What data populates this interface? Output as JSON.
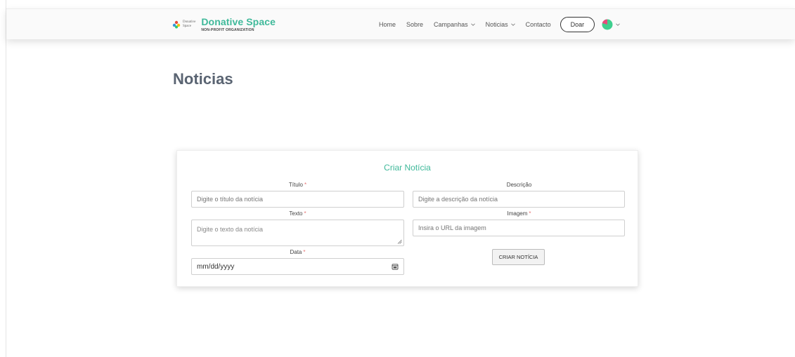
{
  "brand": {
    "logo_small_line1": "Donative",
    "logo_small_line2": "Space",
    "name": "Donative Space",
    "tagline": "NON-PROFIT ORGANIZATION"
  },
  "nav": {
    "items": [
      {
        "label": "Home",
        "dropdown": false
      },
      {
        "label": "Sobre",
        "dropdown": false
      },
      {
        "label": "Campanhas",
        "dropdown": true
      },
      {
        "label": "Noticias",
        "dropdown": true
      },
      {
        "label": "Contacto",
        "dropdown": false
      }
    ],
    "donate_label": "Doar"
  },
  "page": {
    "title": "Noticias"
  },
  "form": {
    "title": "Criar Notícia",
    "required_mark": "*",
    "titulo": {
      "label": "Título",
      "placeholder": "Digite o título da notícia",
      "required": true
    },
    "descricao": {
      "label": "Descrição",
      "placeholder": "Digite a descrição da notícia",
      "required": false
    },
    "texto": {
      "label": "Texto",
      "placeholder": "Digite o texto da notícia",
      "required": true
    },
    "imagem": {
      "label": "Imagem",
      "placeholder": "Insira o URL da imagem",
      "required": true
    },
    "data": {
      "label": "Data",
      "value": "mm/dd/yyyy",
      "required": true
    },
    "submit_label": "CRIAR NOTÍCIA"
  },
  "colors": {
    "accent": "#3fb99a",
    "required": "#e57373",
    "title": "#5a6472"
  },
  "icons": [
    "logo-icon",
    "chevron-down-icon",
    "avatar-pie-icon",
    "calendar-icon",
    "resize-handle-icon"
  ]
}
